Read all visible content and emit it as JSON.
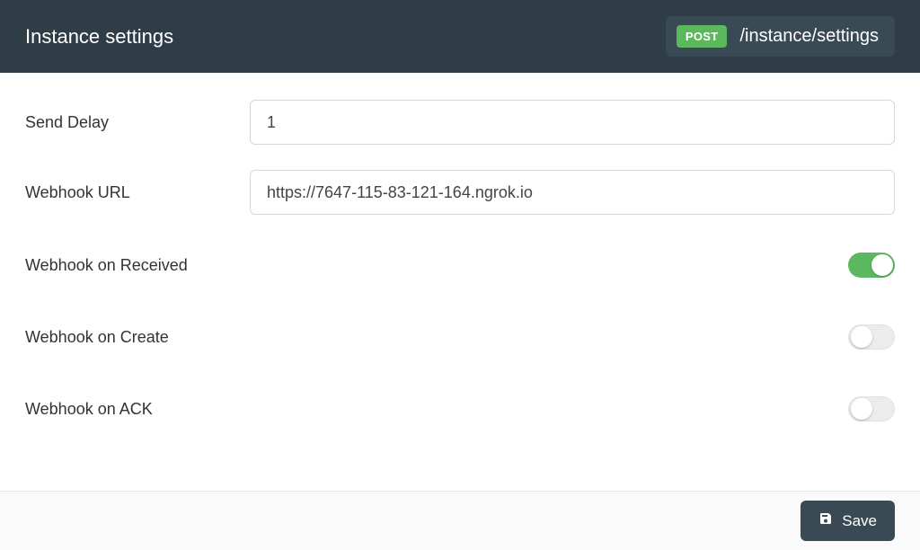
{
  "header": {
    "title": "Instance settings",
    "method": "POST",
    "path": "/instance/settings"
  },
  "form": {
    "send_delay": {
      "label": "Send Delay",
      "value": "1"
    },
    "webhook_url": {
      "label": "Webhook URL",
      "value": "https://7647-115-83-121-164.ngrok.io"
    },
    "webhook_received": {
      "label": "Webhook on Received",
      "value": true
    },
    "webhook_create": {
      "label": "Webhook on Create",
      "value": false
    },
    "webhook_ack": {
      "label": "Webhook on ACK",
      "value": false
    }
  },
  "footer": {
    "save_label": "Save"
  }
}
